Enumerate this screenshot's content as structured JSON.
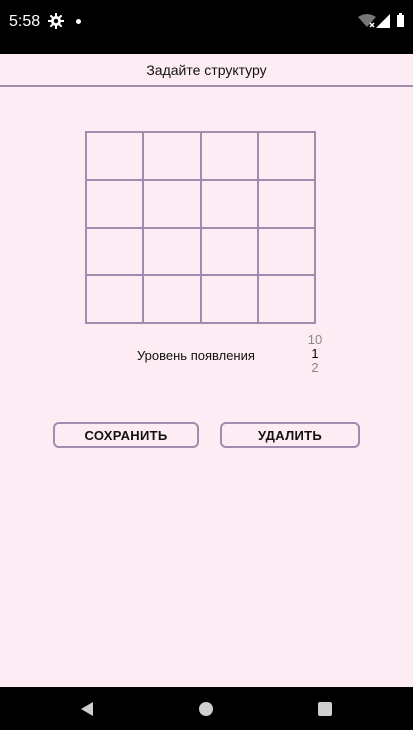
{
  "status_bar": {
    "time": "5:58",
    "icons": [
      "gear-icon",
      "dot-icon",
      "wifi-icon",
      "signal-icon",
      "battery-icon"
    ]
  },
  "toolbar": {
    "title": "Задайте структуру"
  },
  "structure_grid": {
    "rows": 4,
    "cols": 4,
    "line_color": "#a48aac"
  },
  "level": {
    "label": "Уровень появления",
    "options": [
      "10",
      "1",
      "2"
    ],
    "selected": "1"
  },
  "buttons": {
    "save": "СОХРАНИТЬ",
    "delete": "УДАЛИТЬ"
  },
  "nav_bar": {
    "icons": [
      "back-icon",
      "home-icon",
      "recents-icon"
    ]
  },
  "colors": {
    "background": "#fdecf3",
    "accent": "#a48aac"
  }
}
